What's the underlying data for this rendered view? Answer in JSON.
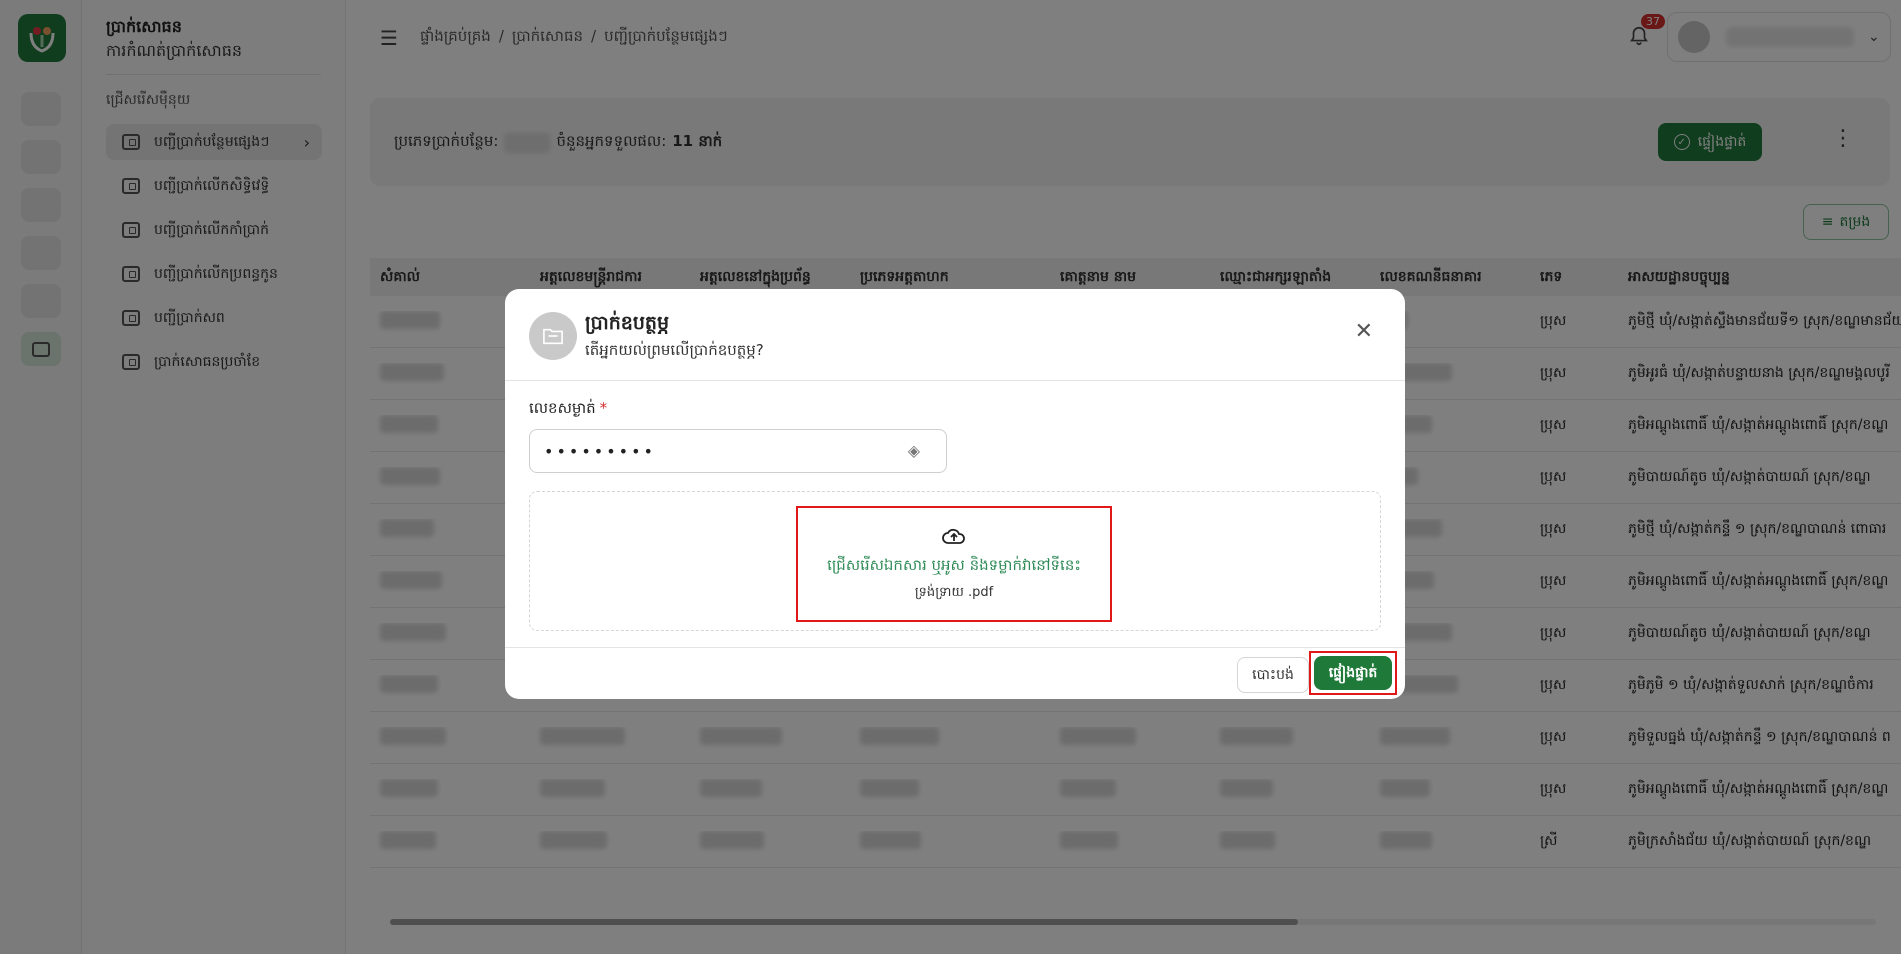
{
  "app": {
    "title": "ប្រាក់សោធន",
    "subtitle": "ការកំណត់ប្រាក់សោធន"
  },
  "subnav": {
    "section": "ជ្រើសរើសមុឺនុយ",
    "items": [
      {
        "label": "បញ្ជីប្រាក់បន្ថែមផ្សេងៗ"
      },
      {
        "label": "បញ្ជីប្រាក់លើកសិទ្ធិវេទ្ធិ"
      },
      {
        "label": "បញ្ជីប្រាក់លើកកាំប្រាក់"
      },
      {
        "label": "បញ្ជីប្រាក់លើកប្រពន្ធកូន"
      },
      {
        "label": "បញ្ជីប្រាក់សព"
      },
      {
        "label": "ប្រាក់សោធនប្រចាំខែ"
      }
    ]
  },
  "header": {
    "breadcrumb": [
      "ផ្ទាំងគ្រប់គ្រង",
      "/",
      "ប្រាក់សោធន",
      "/",
      "បញ្ជីប្រាក់បន្ថែមផ្សេងៗ"
    ],
    "notification_count": "37",
    "user_chevron": "⌄"
  },
  "summary": {
    "type_label": "ប្រភេទប្រាក់បន្ថែម:",
    "count_label": "ចំនួនអ្នកទទួលផល:",
    "count_value": "11 នាក់",
    "confirm_label": "ផ្ទៀងផ្ទាត់"
  },
  "filter_label": "តម្រង",
  "table": {
    "headers": [
      "សំគាល់",
      "អត្តលេខមន្ត្រីរាជការ",
      "អត្តលេខនៅក្នុងប្រព័ន្ធ",
      "ប្រភេទអត្តតាហក",
      "គោត្តនាម នាម",
      "ឈ្មោះជាអក្សរឡាតាំង",
      "លេខគណនីធនាគារ",
      "ភេទ",
      "អាសយដ្ឋានបច្ចុប្បន្ន"
    ],
    "rows": [
      {
        "gender": "ប្រុស",
        "address": "ភូមិថ្មី ឃុំ/សង្កាត់ស្ទឹងមានជ័យទី១ ស្រុក/ខណ្ឌមានជ័យ"
      },
      {
        "gender": "ប្រុស",
        "address": "ភូមិអូរធំ ឃុំ/សង្កាត់បន្ទាយនាង ស្រុក/ខណ្ឌមង្គលបូរី"
      },
      {
        "gender": "ប្រុស",
        "address": "ភូមិអណ្ដូងពោធិ៍ ឃុំ/សង្កាត់អណ្ដូងពោធិ៍ ស្រុក/ខណ្ឌ"
      },
      {
        "gender": "ប្រុស",
        "address": "ភូមិបាយណ៍តូច ឃុំ/សង្កាត់បាយណ៍ ស្រុក/ខណ្ឌ"
      },
      {
        "gender": "ប្រុស",
        "address": "ភូមិថ្មី ឃុំ/សង្កាត់កន្ទឹ ១ ស្រុក/ខណ្ឌបាណន់ ពោធារ"
      },
      {
        "gender": "ប្រុស",
        "address": "ភូមិអណ្ដូងពោធិ៍ ឃុំ/សង្កាត់អណ្ដូងពោធិ៍ ស្រុក/ខណ្ឌ"
      },
      {
        "gender": "ប្រុស",
        "address": "ភូមិបាយណ៍តូច ឃុំ/សង្កាត់បាយណ៍ ស្រុក/ខណ្ឌ"
      },
      {
        "gender": "ប្រុស",
        "address": "ភូមិភូមិ ១ ឃុំ/សង្កាត់ទួលសាក់ ស្រុក/ខណ្ឌចំការ"
      },
      {
        "gender": "ប្រុស",
        "address": "ភូមិទួលធ្នង់ ឃុំ/សង្កាត់កន្ទឹ ១ ស្រុក/ខណ្ឌបាណន់ ព"
      },
      {
        "gender": "ប្រុស",
        "address": "ភូមិអណ្ដូងពោធិ៍ ឃុំ/សង្កាត់អណ្ដូងពោធិ៍ ស្រុក/ខណ្ឌ"
      },
      {
        "gender": "ស្រី",
        "address": "ភូមិក្រសាំងជ័យ ឃុំ/សង្កាត់បាយណ៍ ស្រុក/ខណ្ឌ"
      }
    ]
  },
  "dialog": {
    "title": "ប្រាក់ឧបត្ថម្ភ",
    "subtitle": "តើអ្នកយល់ព្រមលើប្រាក់ឧបត្ថម្ភ?",
    "pin_label": "លេខសម្ងាត់",
    "required_mark": "*",
    "pin_value": "•••••••••",
    "drop_text": "ជ្រើសរើសឯកសារ ឬអូស និងទម្លាក់វានៅទីនេះ",
    "drop_hint": "ទ្រង់ទ្រាយ .pdf",
    "cancel_label": "បោះបង់",
    "confirm_label": "ផ្ទៀងផ្ទាត់"
  },
  "icons": {
    "close": "✕",
    "menu": "☰",
    "bell": "🔔",
    "cloud": "☁",
    "chevron_right": "›",
    "kebab": "⋮",
    "eye": "◈",
    "check": "✓"
  },
  "colors": {
    "brand": "#1f7a3a",
    "danger": "#e01818",
    "badge": "#d32f2f"
  }
}
